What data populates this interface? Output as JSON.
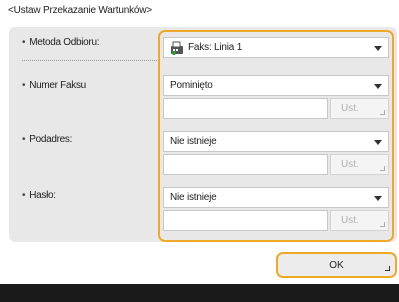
{
  "dialog": {
    "title": "<Ustaw Przekazanie Wartunków>"
  },
  "fields": {
    "method": {
      "label": "Metoda Odbioru:",
      "value": "Faks: Linia 1",
      "icon": "fax-icon"
    },
    "fax_number": {
      "label": "Numer Faksu",
      "value": "Pominięto",
      "button": "Ust."
    },
    "subaddress": {
      "label": "Podadres:",
      "value": "Nie istnieje",
      "button": "Ust."
    },
    "password": {
      "label": "Hasło:",
      "value": "Nie istnieje",
      "button": "Ust."
    }
  },
  "ok_button": "OK",
  "colors": {
    "accent": "#f0a828",
    "panel": "#e8e8e8",
    "bottom_bar": "#1a1a1a"
  }
}
